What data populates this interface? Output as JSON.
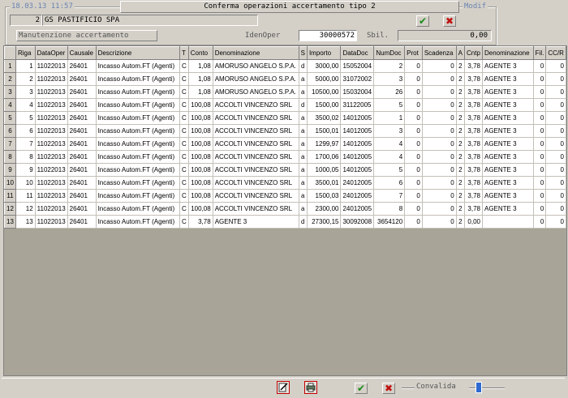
{
  "header": {
    "datetime": "18.03.13 11:57",
    "title": "Conferma operazioni accertamento tipo 2",
    "mode": "Modif",
    "company_code": "2",
    "company_name": "GS PASTIFICIO SPA",
    "section_label": "Manutenzione accertamento",
    "idenoper_label": "IdenOper",
    "idenoper_value": "30000572",
    "sbil_label": "Sbil.",
    "sbil_value": "0,00"
  },
  "grid": {
    "columns": [
      "",
      "Riga",
      "DataOper",
      "Causale",
      "Descrizione",
      "T",
      "Conto",
      "Denominazione",
      "S",
      "Importo",
      "DataDoc",
      "NumDoc",
      "Prot",
      "Scadenza",
      "A",
      "Cntp",
      "Denominazione",
      "Fil.",
      "CC/R"
    ],
    "rows": [
      [
        "1",
        "1",
        "11022013",
        "26401",
        "Incasso Autom.FT (Agenti)",
        "C",
        "1,08",
        "AMORUSO ANGELO S.P.A.",
        "d",
        "3000,00",
        "15052004",
        "2",
        "0",
        "0",
        "2",
        "3,78",
        "AGENTE 3",
        "0",
        "0"
      ],
      [
        "2",
        "2",
        "11022013",
        "26401",
        "Incasso Autom.FT (Agenti)",
        "C",
        "1,08",
        "AMORUSO ANGELO S.P.A.",
        "a",
        "5000,00",
        "31072002",
        "3",
        "0",
        "0",
        "2",
        "3,78",
        "AGENTE 3",
        "0",
        "0"
      ],
      [
        "3",
        "3",
        "11022013",
        "26401",
        "Incasso Autom.FT (Agenti)",
        "C",
        "1,08",
        "AMORUSO ANGELO S.P.A.",
        "a",
        "10500,00",
        "15032004",
        "26",
        "0",
        "0",
        "2",
        "3,78",
        "AGENTE 3",
        "0",
        "0"
      ],
      [
        "4",
        "4",
        "11022013",
        "26401",
        "Incasso Autom.FT (Agenti)",
        "C",
        "100,08",
        "ACCOLTI VINCENZO SRL",
        "d",
        "1500,00",
        "31122005",
        "5",
        "0",
        "0",
        "2",
        "3,78",
        "AGENTE 3",
        "0",
        "0"
      ],
      [
        "5",
        "5",
        "11022013",
        "26401",
        "Incasso Autom.FT (Agenti)",
        "C",
        "100,08",
        "ACCOLTI VINCENZO SRL",
        "a",
        "3500,02",
        "14012005",
        "1",
        "0",
        "0",
        "2",
        "3,78",
        "AGENTE 3",
        "0",
        "0"
      ],
      [
        "6",
        "6",
        "11022013",
        "26401",
        "Incasso Autom.FT (Agenti)",
        "C",
        "100,08",
        "ACCOLTI VINCENZO SRL",
        "a",
        "1500,01",
        "14012005",
        "3",
        "0",
        "0",
        "2",
        "3,78",
        "AGENTE 3",
        "0",
        "0"
      ],
      [
        "7",
        "7",
        "11022013",
        "26401",
        "Incasso Autom.FT (Agenti)",
        "C",
        "100,08",
        "ACCOLTI VINCENZO SRL",
        "a",
        "1299,97",
        "14012005",
        "4",
        "0",
        "0",
        "2",
        "3,78",
        "AGENTE 3",
        "0",
        "0"
      ],
      [
        "8",
        "8",
        "11022013",
        "26401",
        "Incasso Autom.FT (Agenti)",
        "C",
        "100,08",
        "ACCOLTI VINCENZO SRL",
        "a",
        "1700,06",
        "14012005",
        "4",
        "0",
        "0",
        "2",
        "3,78",
        "AGENTE 3",
        "0",
        "0"
      ],
      [
        "9",
        "9",
        "11022013",
        "26401",
        "Incasso Autom.FT (Agenti)",
        "C",
        "100,08",
        "ACCOLTI VINCENZO SRL",
        "a",
        "1000,05",
        "14012005",
        "5",
        "0",
        "0",
        "2",
        "3,78",
        "AGENTE 3",
        "0",
        "0"
      ],
      [
        "10",
        "10",
        "11022013",
        "26401",
        "Incasso Autom.FT (Agenti)",
        "C",
        "100,08",
        "ACCOLTI VINCENZO SRL",
        "a",
        "3500,01",
        "24012005",
        "6",
        "0",
        "0",
        "2",
        "3,78",
        "AGENTE 3",
        "0",
        "0"
      ],
      [
        "11",
        "11",
        "11022013",
        "26401",
        "Incasso Autom.FT (Agenti)",
        "C",
        "100,08",
        "ACCOLTI VINCENZO SRL",
        "a",
        "1500,03",
        "24012005",
        "7",
        "0",
        "0",
        "2",
        "3,78",
        "AGENTE 3",
        "0",
        "0"
      ],
      [
        "12",
        "12",
        "11022013",
        "26401",
        "Incasso Autom.FT (Agenti)",
        "C",
        "100,08",
        "ACCOLTI VINCENZO SRL",
        "a",
        "2300,00",
        "24012005",
        "8",
        "0",
        "0",
        "2",
        "3,78",
        "AGENTE 3",
        "0",
        "0"
      ],
      [
        "13",
        "13",
        "11022013",
        "26401",
        "Incasso Autom.FT (Agenti)",
        "C",
        "3,78",
        "AGENTE 3",
        "d",
        "27300,15",
        "30092008",
        "3654120",
        "0",
        "0",
        "2",
        "0,00",
        "",
        "0",
        "0"
      ]
    ]
  },
  "footer": {
    "convalida_label": "Convalida"
  },
  "icons": {
    "confirm": "check-icon",
    "cancel": "cross-icon",
    "tool1": "edit-doc-icon",
    "tool2": "print-icon"
  }
}
